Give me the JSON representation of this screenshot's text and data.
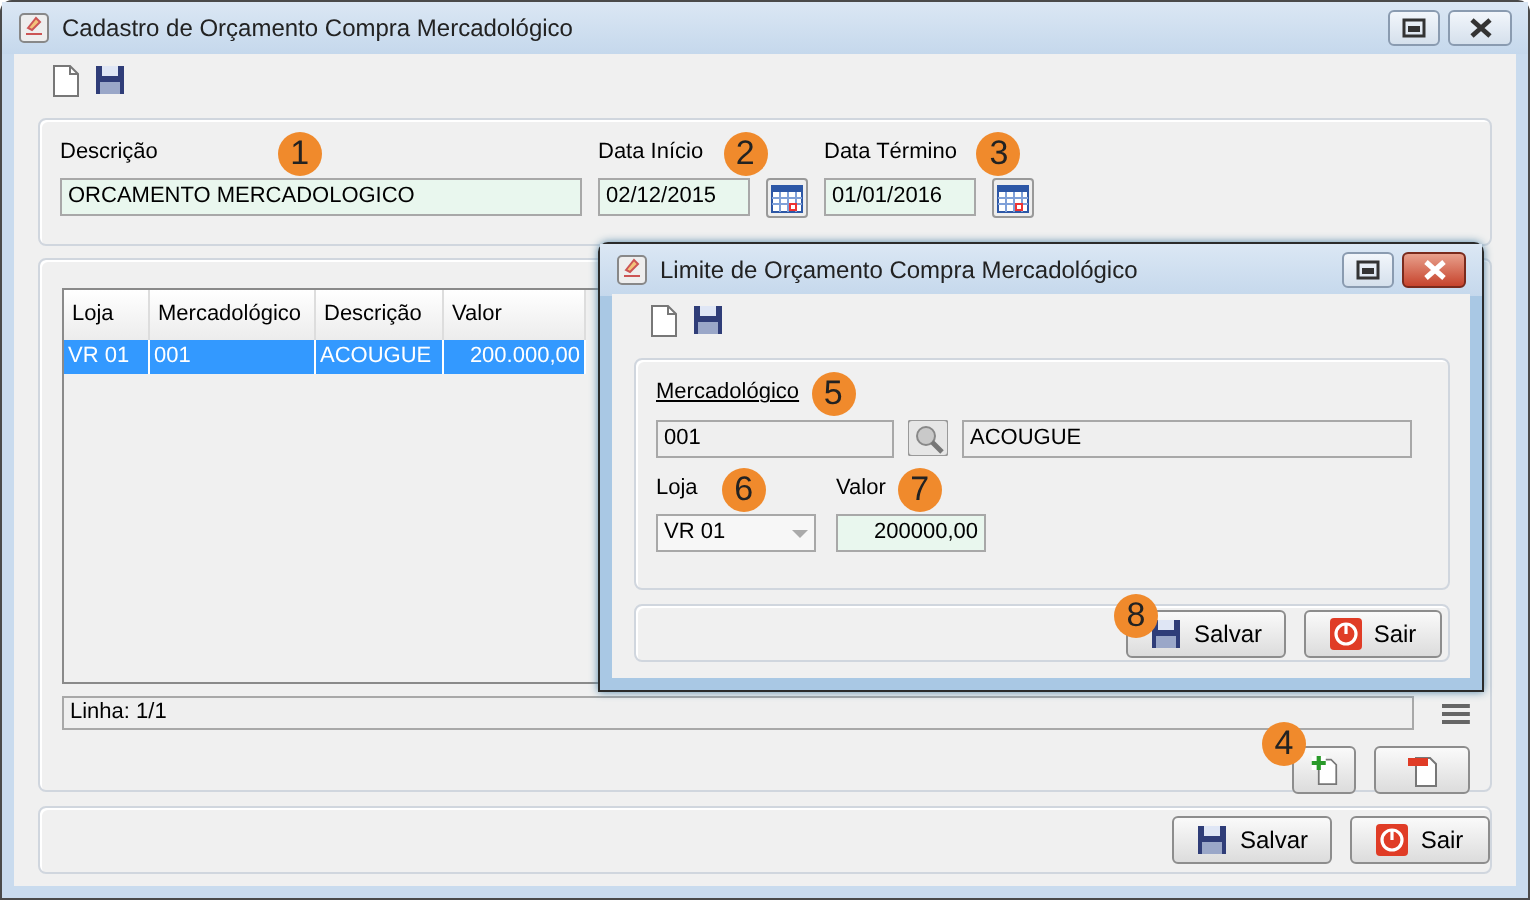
{
  "window": {
    "title": "Cadastro de Orçamento Compra Mercadológico"
  },
  "form": {
    "fields": [
      {
        "kind": "text",
        "label": "Descrição",
        "value": "ORCAMENTO MERCADOLOGICO",
        "callout": "1"
      },
      {
        "kind": "date",
        "label": "Data Início",
        "value": "02/12/2015",
        "callout": "2"
      },
      {
        "kind": "date",
        "label": "Data Término",
        "value": "01/01/2016",
        "callout": "3"
      }
    ]
  },
  "table": {
    "columns": [
      "Loja",
      "Mercadológico",
      "Descrição",
      "Valor"
    ],
    "rows": [
      {
        "cells": [
          "VR 01",
          "001",
          "ACOUGUE",
          "200.000,00"
        ],
        "selected": true
      }
    ]
  },
  "status_bar": "Linha: 1/1",
  "row_buttons_callout": "4",
  "buttons": [
    {
      "kind": "save",
      "label": "Salvar"
    },
    {
      "kind": "exit",
      "label": "Sair"
    }
  ],
  "dialog": {
    "title": "Limite de Orçamento Compra Mercadológico",
    "mercadologico": {
      "label": "Mercadológico",
      "callout": "5",
      "code": "001",
      "description": "ACOUGUE"
    },
    "loja": {
      "label": "Loja",
      "callout": "6",
      "value": "VR 01"
    },
    "valor": {
      "label": "Valor",
      "callout": "7",
      "value": "200000,00"
    },
    "buttons": [
      {
        "kind": "save",
        "label": "Salvar",
        "callout": "8"
      },
      {
        "kind": "exit",
        "label": "Sair"
      }
    ]
  }
}
